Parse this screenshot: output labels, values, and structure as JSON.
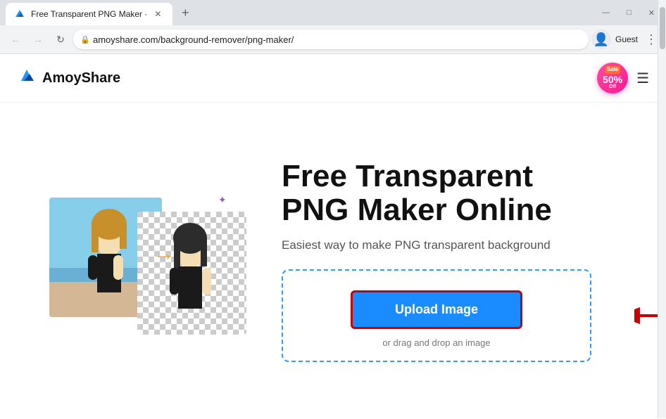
{
  "browser": {
    "tab_title": "Free Transparent PNG Maker ·",
    "tab_favicon": "🖼",
    "new_tab_icon": "+",
    "window_minimize": "—",
    "window_maximize": "□",
    "window_close": "✕",
    "nav_back": "←",
    "nav_forward": "→",
    "nav_refresh": "↻",
    "address_url": "amoyshare.com/background-remover/png-maker/",
    "lock_icon": "🔒",
    "profile_icon": "👤",
    "guest_label": "Guest",
    "menu_icon": "⋮"
  },
  "site": {
    "logo_text": "AmoyShare",
    "logo_icon": "✦",
    "sale_badge_sale": "Sale",
    "sale_badge_percent": "50%",
    "sale_badge_off": "Off",
    "hamburger": "☰"
  },
  "page": {
    "headline_line1": "Free Transparent",
    "headline_line2": "PNG Maker Online",
    "subtext": "Easiest way to make PNG transparent background",
    "upload_button": "Upload Image",
    "upload_hint": "or drag and drop an image"
  }
}
